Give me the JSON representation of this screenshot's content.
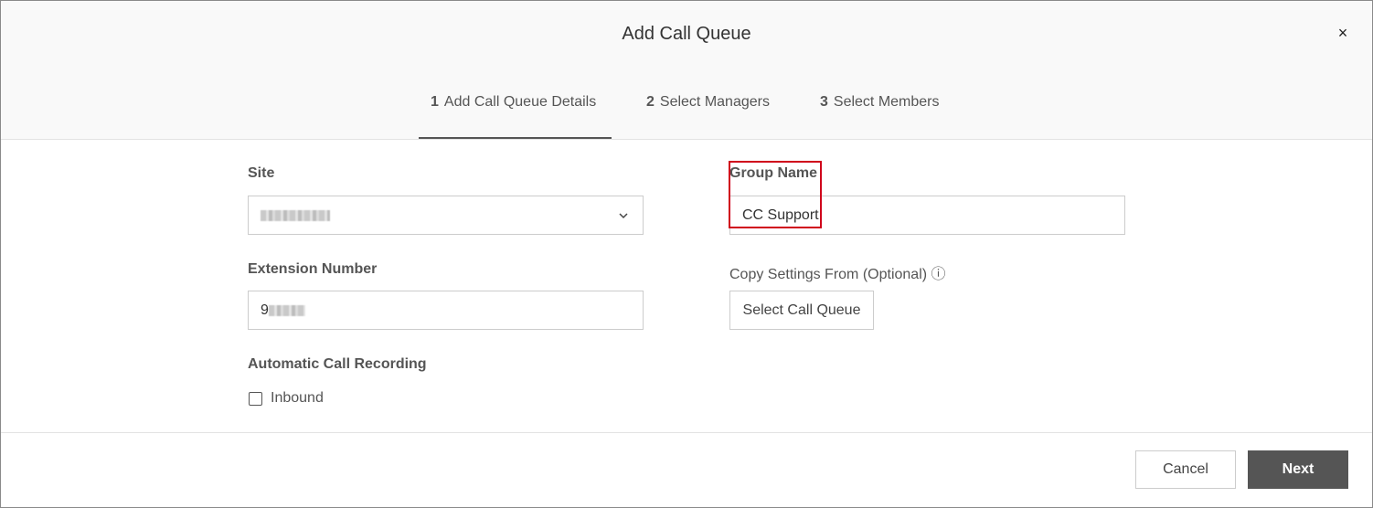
{
  "dialog": {
    "title": "Add Call Queue",
    "close_label": "×"
  },
  "tabs": [
    {
      "number": "1",
      "label": "Add Call Queue Details",
      "active": true
    },
    {
      "number": "2",
      "label": "Select Managers",
      "active": false
    },
    {
      "number": "3",
      "label": "Select Members",
      "active": false
    }
  ],
  "form": {
    "site_label": "Site",
    "site_value_redacted": true,
    "group_name_label": "Group Name",
    "group_name_value": "CC Support",
    "extension_label": "Extension Number",
    "extension_value_visible": "9",
    "copy_settings_label": "Copy Settings From (Optional) ⓘ",
    "select_call_queue_label": "Select Call Queue",
    "recording_label": "Automatic Call Recording",
    "inbound_label": "Inbound",
    "inbound_checked": false
  },
  "footer": {
    "cancel_label": "Cancel",
    "next_label": "Next"
  },
  "colors": {
    "highlight": "#d0021b",
    "primary_button": "#555555",
    "header_bg": "#f9f9f9"
  },
  "icons": {
    "close": "close-icon",
    "dropdown": "chevron-down-icon",
    "info": "info-icon"
  }
}
